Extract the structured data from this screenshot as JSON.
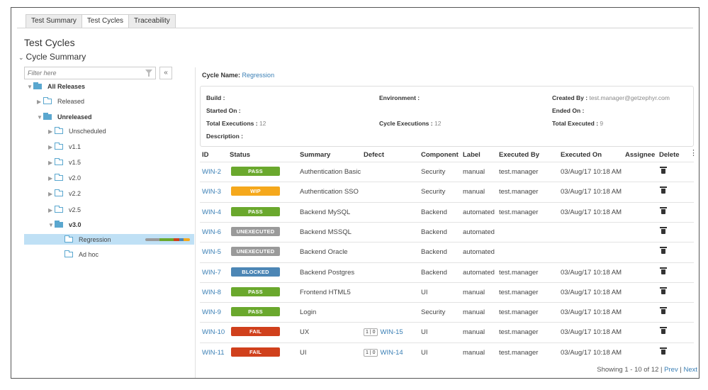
{
  "tabs": [
    {
      "label": "Test Summary",
      "active": false
    },
    {
      "label": "Test Cycles",
      "active": true
    },
    {
      "label": "Traceability",
      "active": false
    }
  ],
  "page_title": "Test Cycles",
  "section_title": "Cycle Summary",
  "filter": {
    "placeholder": "Filter here"
  },
  "collapse_label": "«",
  "tree": {
    "root": "All Releases",
    "released": "Released",
    "unreleased": "Unreleased",
    "unscheduled": "Unscheduled",
    "v11": "v1.1",
    "v15": "v1.5",
    "v20": "v2.0",
    "v22": "v2.2",
    "v25": "v2.5",
    "v30": "v3.0",
    "regression": "Regression",
    "adhoc": "Ad hoc"
  },
  "cycle": {
    "name_label": "Cycle Name:",
    "name_value": "Regression",
    "build_label": "Build :",
    "environment_label": "Environment :",
    "created_by_label": "Created By :",
    "created_by_value": "test.manager@getzephyr.com",
    "started_on_label": "Started On :",
    "ended_on_label": "Ended On :",
    "total_exec_label": "Total Executions :",
    "total_exec_value": "12",
    "cycle_exec_label": "Cycle Executions :",
    "cycle_exec_value": "12",
    "total_executed_label": "Total Executed :",
    "total_executed_value": "9",
    "description_label": "Description :"
  },
  "table": {
    "headers": {
      "id": "ID",
      "status": "Status",
      "summary": "Summary",
      "defect": "Defect",
      "component": "Component",
      "label": "Label",
      "executed_by": "Executed By",
      "executed_on": "Executed On",
      "assignee": "Assignee",
      "delete": "Delete"
    },
    "rows": [
      {
        "id": "WIN-2",
        "status": "PASS",
        "summary": "Authentication Basic",
        "badge": "",
        "defect": "",
        "component": "Security",
        "label": "manual",
        "executed_by": "test.manager",
        "executed_on": "03/Aug/17 10:18 AM"
      },
      {
        "id": "WIN-3",
        "status": "WIP",
        "summary": "Authentication SSO",
        "badge": "",
        "defect": "",
        "component": "Security",
        "label": "manual",
        "executed_by": "test.manager",
        "executed_on": "03/Aug/17 10:18 AM"
      },
      {
        "id": "WIN-4",
        "status": "PASS",
        "summary": "Backend MySQL",
        "badge": "",
        "defect": "",
        "component": "Backend",
        "label": "automated",
        "executed_by": "test.manager",
        "executed_on": "03/Aug/17 10:18 AM"
      },
      {
        "id": "WIN-6",
        "status": "UNEXECUTED",
        "summary": "Backend MSSQL",
        "badge": "",
        "defect": "",
        "component": "Backend",
        "label": "automated",
        "executed_by": "",
        "executed_on": ""
      },
      {
        "id": "WIN-5",
        "status": "UNEXECUTED",
        "summary": "Backend Oracle",
        "badge": "",
        "defect": "",
        "component": "Backend",
        "label": "automated",
        "executed_by": "",
        "executed_on": ""
      },
      {
        "id": "WIN-7",
        "status": "BLOCKED",
        "summary": "Backend Postgres",
        "badge": "",
        "defect": "",
        "component": "Backend",
        "label": "automated",
        "executed_by": "test.manager",
        "executed_on": "03/Aug/17 10:18 AM"
      },
      {
        "id": "WIN-8",
        "status": "PASS",
        "summary": "Frontend HTML5",
        "badge": "",
        "defect": "",
        "component": "UI",
        "label": "manual",
        "executed_by": "test.manager",
        "executed_on": "03/Aug/17 10:18 AM"
      },
      {
        "id": "WIN-9",
        "status": "PASS",
        "summary": "Login",
        "badge": "",
        "defect": "",
        "component": "Security",
        "label": "manual",
        "executed_by": "test.manager",
        "executed_on": "03/Aug/17 10:18 AM"
      },
      {
        "id": "WIN-10",
        "status": "FAIL",
        "summary": "UX",
        "badge": "1 | 0",
        "defect": "WIN-15",
        "component": "UI",
        "label": "manual",
        "executed_by": "test.manager",
        "executed_on": "03/Aug/17 10:18 AM"
      },
      {
        "id": "WIN-11",
        "status": "FAIL",
        "summary": "UI",
        "badge": "1 | 0",
        "defect": "WIN-14",
        "component": "UI",
        "label": "manual",
        "executed_by": "test.manager",
        "executed_on": "03/Aug/17 10:18 AM"
      }
    ]
  },
  "pager": {
    "text": "Showing 1 - 10 of 12 |",
    "prev": "Prev",
    "sep": "|",
    "next": "Next"
  },
  "colors": {
    "PASS": "#6aa82d",
    "WIP": "#f5a81c",
    "UNEXECUTED": "#9a9a9a",
    "BLOCKED": "#4c86b5",
    "FAIL": "#d0401c",
    "link": "#3a7fb5"
  },
  "icons": {
    "folder": "folder-icon",
    "trash": "trash-icon",
    "funnel": "filter-icon"
  }
}
